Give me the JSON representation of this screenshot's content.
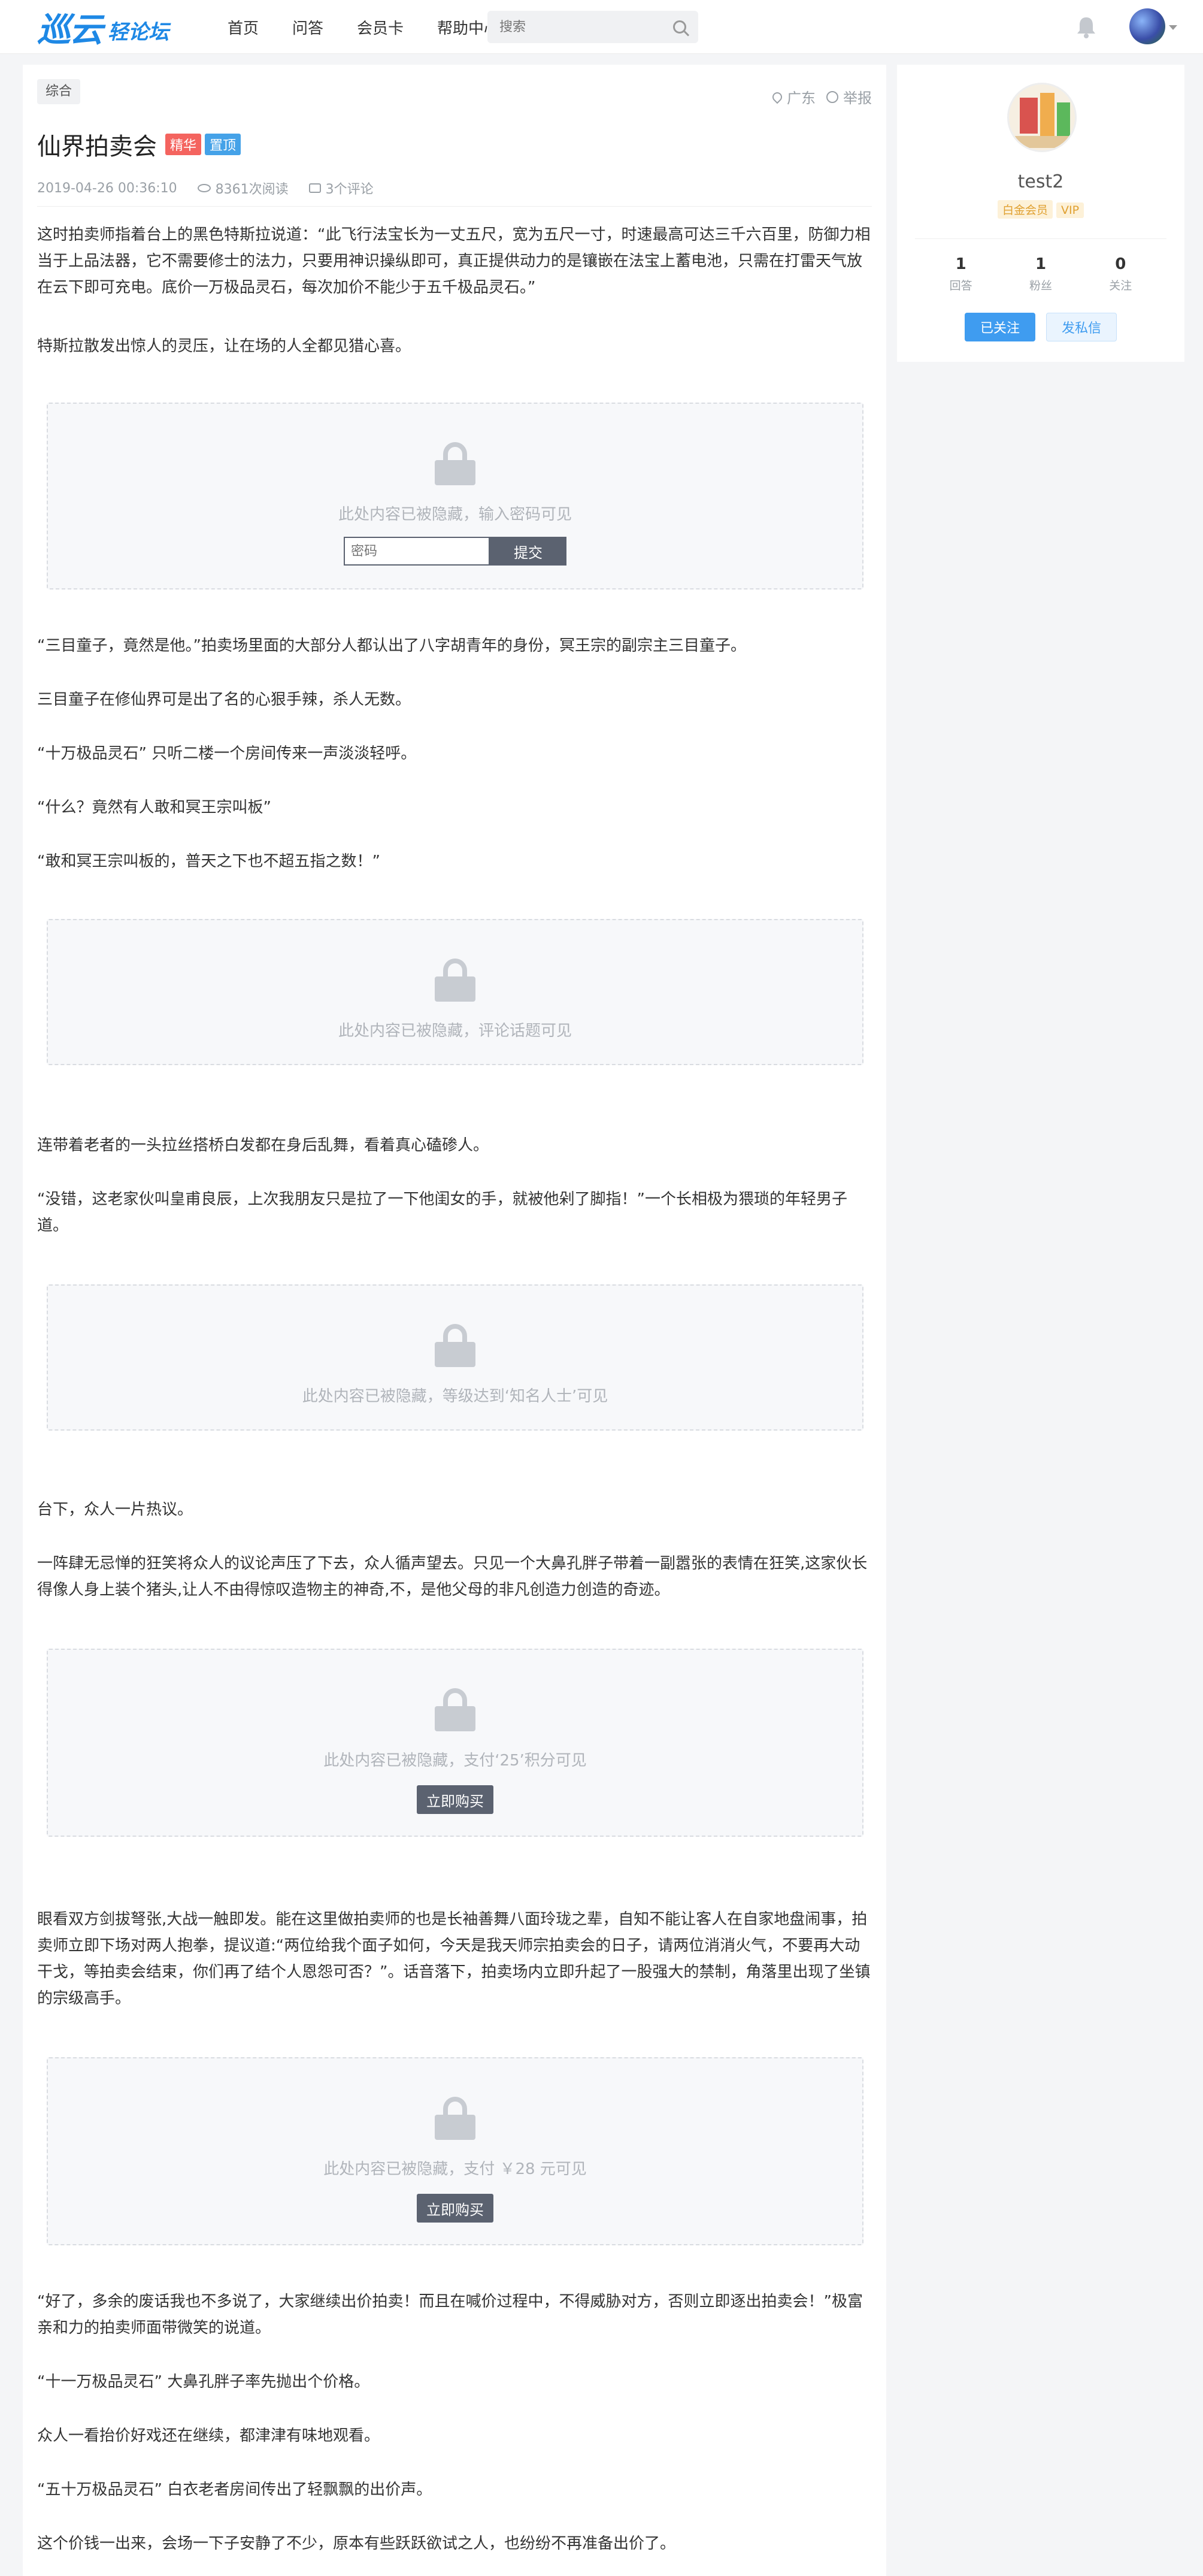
{
  "header": {
    "logo_main": "巡云",
    "logo_sub": "轻论坛",
    "nav": [
      "首页",
      "问答",
      "会员卡",
      "帮助中心"
    ],
    "search_placeholder": "搜索"
  },
  "post": {
    "category": "综合",
    "location": "广东",
    "report": "举报",
    "title": "仙界拍卖会",
    "badges": [
      "精华",
      "置顶"
    ],
    "date": "2019-04-26 00:36:10",
    "views": "8361次阅读",
    "comments": "3个评论",
    "paragraphs": [
      "这时拍卖师指着台上的黑色特斯拉说道：“此飞行法宝长为一丈五尺，宽为五尺一寸，时速最高可达三千六百里，防御力相当于上品法器，它不需要修士的法力，只要用神识操纵即可，真正提供动力的是镶嵌在法宝上蓄电池，只需在打雷天气放在云下即可充电。底价一万极品灵石，每次加价不能少于五千极品灵石。”",
      "特斯拉散发出惊人的灵压，让在场的人全都见猎心喜。",
      "“三目童子，竟然是他。”拍卖场里面的大部分人都认出了八字胡青年的身份，冥王宗的副宗主三目童子。",
      "三目童子在修仙界可是出了名的心狠手辣，杀人无数。",
      "“十万极品灵石” 只听二楼一个房间传来一声淡淡轻呼。",
      "“什么？竟然有人敢和冥王宗叫板”",
      "“敢和冥王宗叫板的，普天之下也不超五指之数！”",
      "连带着老者的一头拉丝搭桥白发都在身后乱舞，看着真心磕碜人。",
      "“没错，这老家伙叫皇甫良辰，上次我朋友只是拉了一下他闺女的手，就被他剁了脚指！”一个长相极为猥琐的年轻男子道。",
      "台下，众人一片热议。",
      "一阵肆无忌惮的狂笑将众人的议论声压了下去，众人循声望去。只见一个大鼻孔胖子带着一副嚣张的表情在狂笑,这家伙长得像人身上装个猪头,让人不由得惊叹造物主的神奇,不，是他父母的非凡创造力创造的奇迹。",
      "眼看双方剑拔弩张,大战一触即发。能在这里做拍卖师的也是长袖善舞八面玲珑之辈，自知不能让客人在自家地盘闹事，拍卖师立即下场对两人抱拳，提议道:“两位给我个面子如何，今天是我天师宗拍卖会的日子，请两位消消火气，不要再大动干戈，等拍卖会结束，你们再了结个人恩怨可否？”。话音落下，拍卖场内立即升起了一股强大的禁制，角落里出现了坐镇的宗级高手。",
      "“好了，多余的废话我也不多说了，大家继续出价拍卖！而且在喊价过程中，不得威胁对方，否则立即逐出拍卖会！”极富亲和力的拍卖师面带微笑的说道。",
      "“十一万极品灵石” 大鼻孔胖子率先抛出个价格。",
      "众人一看抬价好戏还在继续，都津津有味地观看。",
      "“五十万极品灵石” 白衣老者房间传出了轻飘飘的出价声。",
      "这个价钱一出来，会场一下子安静了不少，原本有些跃跃欲试之人，也纷纷不再准备出价了。"
    ],
    "hidden": {
      "password_text": "此处内容已被隐藏，输入密码可见",
      "password_placeholder": "密码",
      "submit_label": "提交",
      "comment_text": "此处内容已被隐藏，评论话题可见",
      "level_text": "此处内容已被隐藏，等级达到‘知名人士’可见",
      "points_text": "此处内容已被隐藏，支付‘25’积分可见",
      "buy_label": "立即购买",
      "pay_text": "此处内容已被隐藏，支付 ￥28 元可见"
    }
  },
  "sidebar": {
    "username": "test2",
    "badges": [
      "白金会员",
      "VIP"
    ],
    "stats": [
      {
        "num": "1",
        "label": "回答"
      },
      {
        "num": "1",
        "label": "粉丝"
      },
      {
        "num": "0",
        "label": "关注"
      }
    ],
    "follow_label": "已关注",
    "message_label": "发私信"
  },
  "colors": {
    "brand": "#1e88e5",
    "badge_red": "#f4645f",
    "badge_blue": "#45a2e8",
    "button_dark": "#5b6270",
    "follow_blue": "#3f9cf0"
  }
}
